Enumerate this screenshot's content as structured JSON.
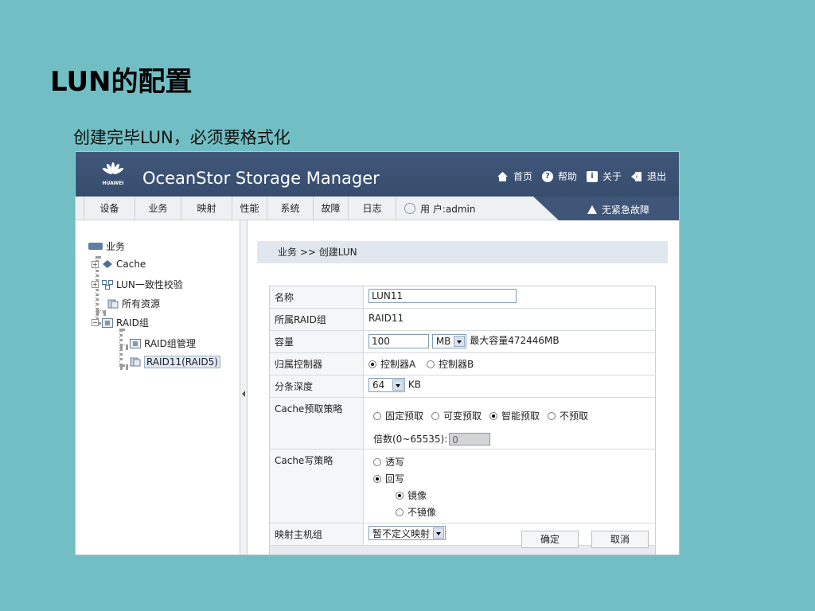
{
  "slide": {
    "title": "LUN的配置",
    "subtitle": "创建完毕LUN，必须要格式化"
  },
  "app": {
    "logo_text": "HUAWEI",
    "title": "OceanStor Storage Manager",
    "header_links": [
      {
        "label": "首页",
        "icon": "home-icon"
      },
      {
        "label": "帮助",
        "icon": "help-icon"
      },
      {
        "label": "关于",
        "icon": "info-icon"
      },
      {
        "label": "退出",
        "icon": "logout-icon"
      }
    ],
    "menu": [
      "设备",
      "业务",
      "映射",
      "性能",
      "系统",
      "故障",
      "日志"
    ],
    "user": "用 户:admin",
    "alarm": "无紧急故障",
    "colors": {
      "header": "#3f5679",
      "accent_selected": "#dfe8f3",
      "background": "#71bfc4"
    }
  },
  "tree": {
    "root": "业务",
    "items": [
      "Cache",
      "LUN一致性校验",
      "所有资源",
      "RAID组",
      "RAID组管理",
      "RAID11(RAID5)"
    ]
  },
  "breadcrumb": "业务 >> 创建LUN",
  "form": {
    "name_label": "名称",
    "name_value": "LUN11",
    "raid_label": "所属RAID组",
    "raid_value": "RAID11",
    "capacity_label": "容量",
    "capacity_value": "100",
    "capacity_unit": "MB",
    "capacity_max": "最大容量472446MB",
    "controller_label": "归属控制器",
    "controller_a": "控制器A",
    "controller_b": "控制器B",
    "stripe_label": "分条深度",
    "stripe_value": "64",
    "stripe_unit": "KB",
    "prefetch_label": "Cache预取策略",
    "prefetch_fixed": "固定预取",
    "prefetch_variable": "可变预取",
    "prefetch_smart": "智能预取",
    "prefetch_none": "不预取",
    "multiplier_label": "倍数(0~65535):",
    "multiplier_value": "0",
    "write_label": "Cache写策略",
    "write_through": "透写",
    "write_back": "回写",
    "mirror": "镜像",
    "no_mirror": "不镜像",
    "mapping_label": "映射主机组",
    "mapping_value": "暂不定义映射",
    "ok": "确定",
    "cancel": "取消"
  }
}
